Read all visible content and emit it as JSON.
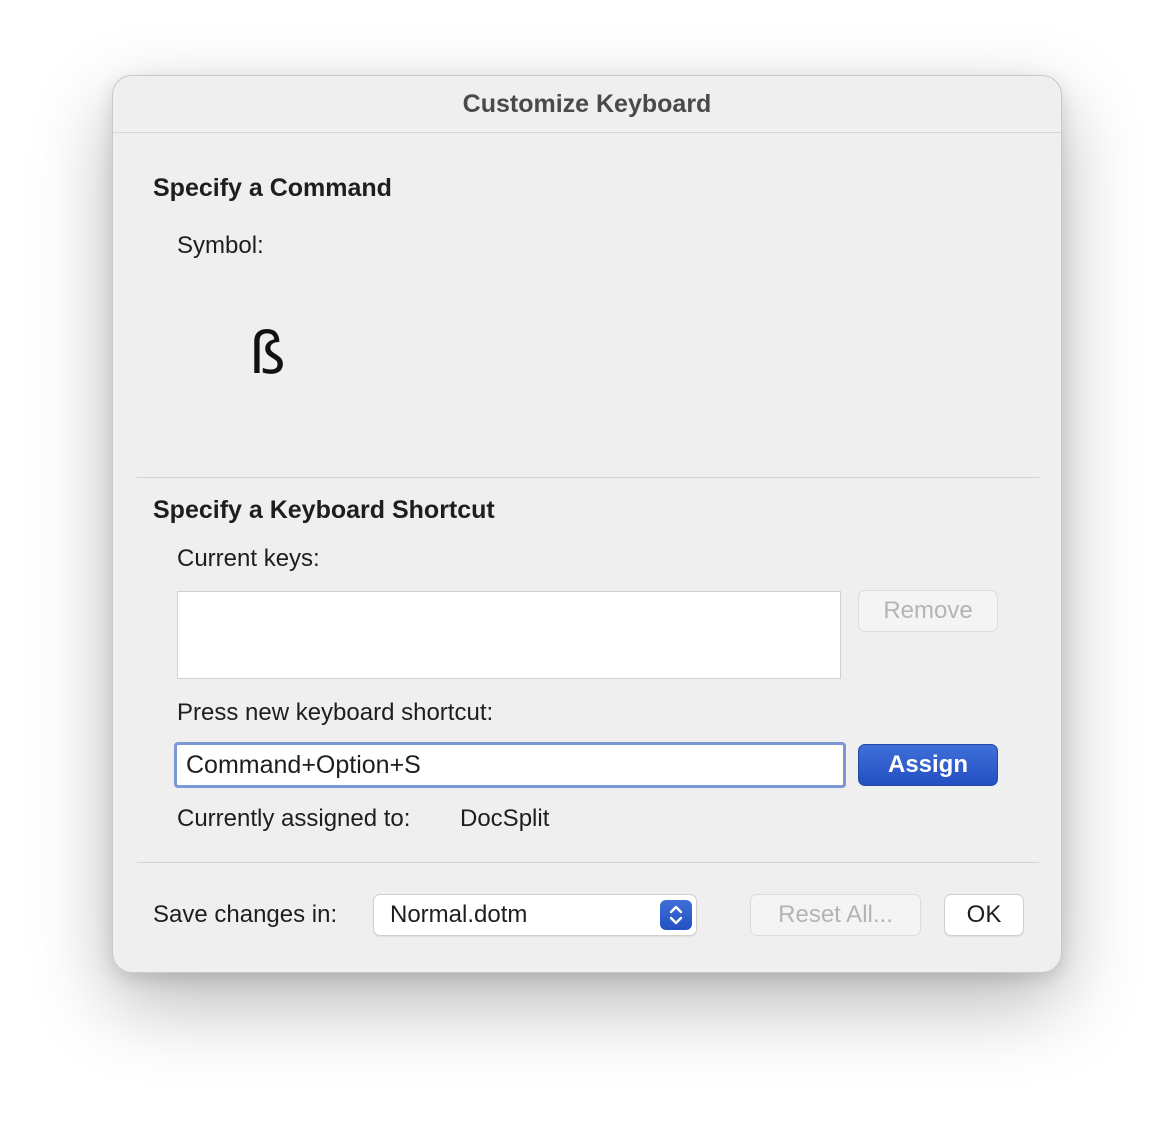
{
  "dialog": {
    "title": "Customize Keyboard"
  },
  "command_section": {
    "heading": "Specify a Command",
    "symbol_label": "Symbol:",
    "symbol_value": "ß"
  },
  "shortcut_section": {
    "heading": "Specify a Keyboard Shortcut",
    "current_keys_label": "Current keys:",
    "current_keys": [],
    "remove_label": "Remove",
    "press_new_label": "Press new keyboard shortcut:",
    "new_shortcut_value": "Command+Option+S",
    "assign_label": "Assign",
    "currently_assigned_label": "Currently assigned to:",
    "currently_assigned_value": "DocSplit"
  },
  "footer": {
    "save_changes_label": "Save changes in:",
    "save_changes_value": "Normal.dotm",
    "reset_all_label": "Reset All...",
    "ok_label": "OK"
  },
  "colors": {
    "accent": "#2b5cd0",
    "dialog_background": "#efefef",
    "disabled_text": "#b4b4b4"
  }
}
